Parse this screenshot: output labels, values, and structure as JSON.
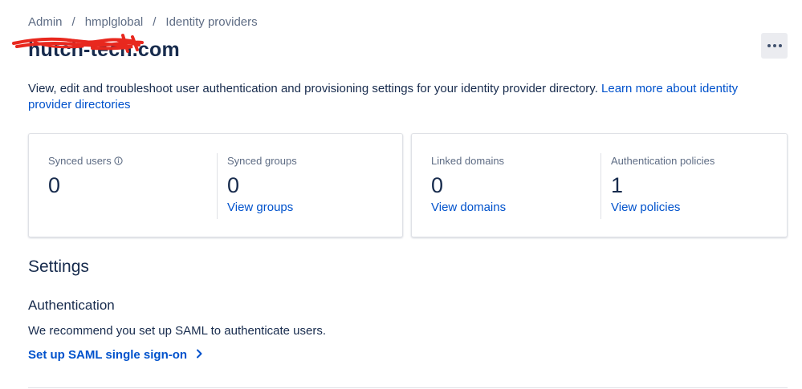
{
  "breadcrumb": {
    "items": [
      "Admin",
      "hmplglobal",
      "Identity providers"
    ],
    "separator": "/"
  },
  "page": {
    "title": "hutch-tech.com",
    "more_icon": "more-horizontal-icon"
  },
  "description": {
    "text": "View, edit and troubleshoot user authentication and provisioning settings for your identity provider directory. ",
    "link": "Learn more about identity provider directories"
  },
  "stats": {
    "synced_users": {
      "label": "Synced users",
      "value": "0",
      "icon": "info-icon"
    },
    "synced_groups": {
      "label": "Synced groups",
      "value": "0",
      "link": "View groups"
    },
    "linked_domains": {
      "label": "Linked domains",
      "value": "0",
      "link": "View domains"
    },
    "auth_policies": {
      "label": "Authentication policies",
      "value": "1",
      "link": "View policies"
    }
  },
  "settings": {
    "heading": "Settings",
    "authentication": {
      "heading": "Authentication",
      "description": "We recommend you set up SAML to authenticate users.",
      "link": "Set up SAML single sign-on",
      "link_icon": "chevron-right-icon"
    }
  },
  "colors": {
    "link": "#0052cc",
    "text": "#172b4d",
    "muted": "#5e6c84",
    "border": "#dfe1e6",
    "redaction": "#e8281e"
  }
}
